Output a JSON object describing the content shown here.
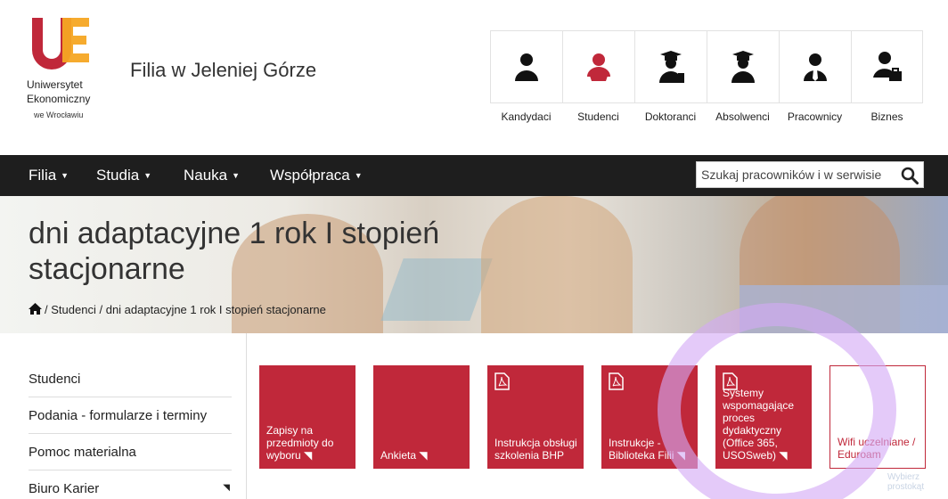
{
  "header": {
    "logo_mark": "UE",
    "logo_line1": "Uniwersytet",
    "logo_line2": "Ekonomiczny",
    "logo_line3": "we Wrocławiu",
    "site_name": "Filia w Jeleniej Górze",
    "portals": [
      {
        "label": "Kandydaci",
        "icon": "person-icon",
        "color": "#111111"
      },
      {
        "label": "Studenci",
        "icon": "student-icon",
        "color": "#c0283a"
      },
      {
        "label": "Doktoranci",
        "icon": "doctorate-icon",
        "color": "#111111"
      },
      {
        "label": "Absolwenci",
        "icon": "graduate-icon",
        "color": "#111111"
      },
      {
        "label": "Pracownicy",
        "icon": "employee-icon",
        "color": "#111111"
      },
      {
        "label": "Biznes",
        "icon": "business-icon",
        "color": "#111111"
      }
    ]
  },
  "nav": {
    "items": [
      "Filia",
      "Studia",
      "Nauka",
      "Współpraca"
    ],
    "search_placeholder": "Szukaj pracowników i w serwisie"
  },
  "hero": {
    "title": "dni adaptacyjne 1 rok I stopień stacjonarne",
    "breadcrumb": [
      "Studenci",
      "dni adaptacyjne 1 rok I stopień stacjonarne"
    ],
    "breadcrumb_sep": "/"
  },
  "sidebar": {
    "items": [
      "Studenci",
      "Podania - formularze i terminy",
      "Pomoc materialna",
      "Biuro Karier"
    ]
  },
  "tiles": [
    {
      "label": "Zapisy na przedmioty do wyboru",
      "pdf": false
    },
    {
      "label": "Ankieta",
      "pdf": false
    },
    {
      "label": "Instrukcja obsługi szkolenia BHP",
      "pdf": true
    },
    {
      "label": "Instrukcje - Biblioteka Filii",
      "pdf": true
    },
    {
      "label": "Systemy wspomagające proces dydaktyczny (Office 365, USOSweb)",
      "pdf": true
    },
    {
      "label": "Wifi uczelniane / Eduroam",
      "pdf": false
    }
  ],
  "overlay_text": "Wybierz prostokąt",
  "colors": {
    "brand_red": "#c0283a",
    "nav_bg": "#1e1e1e",
    "logo_orange": "#f5a623",
    "highlight": "#d4aaf5"
  }
}
